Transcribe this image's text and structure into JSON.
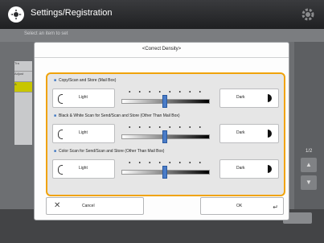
{
  "app": {
    "title": "Settings/Registration",
    "icon": "settings-registration-icon"
  },
  "background": {
    "instruction": "Select an item to set",
    "list_items": [
      "Tra",
      "Adjust",
      "A",
      ""
    ],
    "page_indicator": "1/2",
    "page_up": "▲",
    "page_down": "▼"
  },
  "dialog": {
    "title": "<Correct Density>",
    "sections": [
      {
        "label": "Copy/Scan and Store (Mail Box)",
        "light": "Light",
        "dark": "Dark",
        "level": 0.5
      },
      {
        "label": "Black & White Scan for Send/Scan and Store (Other Than Mail Box)",
        "light": "Light",
        "dark": "Dark",
        "level": 0.5
      },
      {
        "label": "Color Scan for Send/Scan and Store (Other Than Mail Box)",
        "light": "Light",
        "dark": "Dark",
        "level": 0.5
      }
    ],
    "cancel_label": "Cancel",
    "ok_label": "OK"
  },
  "colors": {
    "highlight_frame": "#f0a30a",
    "slider_knob": "#4a7cc8"
  }
}
